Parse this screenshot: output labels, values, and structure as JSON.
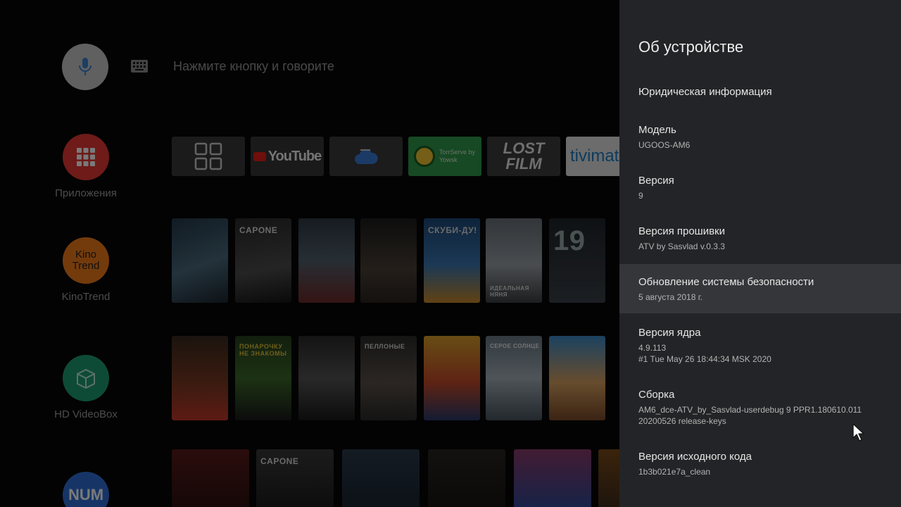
{
  "launcher": {
    "search_hint": "Нажмите кнопку и говорите",
    "nav": [
      {
        "label": "Приложения"
      },
      {
        "label": "KinoTrend",
        "logo_text": "Kino Trend"
      },
      {
        "label": "HD VideoBox"
      },
      {
        "label": "NUM",
        "logo_text": "NUM"
      }
    ],
    "apps": [
      {
        "name": "apps-grid-icon"
      },
      {
        "text": "YouTube"
      },
      {
        "name": "cloud-icon"
      },
      {
        "text": "TorrServe by Yowsk"
      },
      {
        "text": "LOST FILM"
      },
      {
        "text": "tivimate"
      }
    ],
    "posters": [
      "",
      "CAPONE",
      "",
      "",
      "СКУБИ-ДУ!",
      "ИДЕАЛЬНАЯ НЯНЯ",
      "19",
      "",
      "ПОНАРОЧКУ НЕ ЗНАКОМЫ",
      "",
      "ПЕЛЛОНЫЕ",
      "",
      "СЕРОЕ СОЛНЦЕ",
      "",
      "",
      "CAPONE",
      "",
      "",
      "",
      ""
    ]
  },
  "panel": {
    "title": "Об устройстве",
    "items": [
      {
        "title": "Юридическая информация"
      },
      {
        "title": "Модель",
        "sub": "UGOOS-AM6"
      },
      {
        "title": "Версия",
        "sub": "9"
      },
      {
        "title": "Версия прошивки",
        "sub": "ATV by Sasvlad v.0.3.3"
      },
      {
        "title": "Обновление системы безопасности",
        "sub": "5 августа 2018 г."
      },
      {
        "title": "Версия ядра",
        "sub": "4.9.113",
        "sub2": "#1 Tue May 26 18:44:34 MSK 2020"
      },
      {
        "title": "Сборка",
        "sub": "AM6_dce-ATV_by_Sasvlad-userdebug 9 PPR1.180610.011",
        "sub2": "20200526 release-keys"
      },
      {
        "title": "Версия исходного кода",
        "sub": "1b3b021e7a_clean"
      }
    ]
  },
  "colors": {
    "panel_bg": "#232427",
    "panel_focus": "#35363a",
    "launcher_bg": "#070707"
  }
}
